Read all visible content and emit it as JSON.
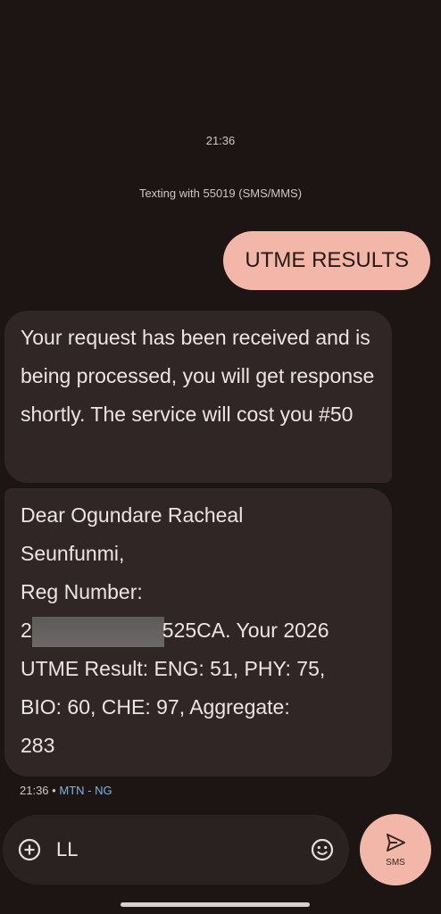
{
  "thread": {
    "time_header": "21:36",
    "info": "Texting with 55019 (SMS/MMS)"
  },
  "messages": {
    "outgoing_1": "UTME RESULTS",
    "incoming_1": "Your request has been received and is being processed, you will get response shortly. The service will cost you #50",
    "incoming_2": {
      "line1": "Dear Ogundare Racheal",
      "line2": "Seunfunmi,",
      "line3": "Reg Number:",
      "reg_prefix": "2",
      "reg_suffix": "525CA. Your 2026",
      "line5": "UTME Result: ENG: 51, PHY: 75,",
      "line6": "BIO: 60, CHE: 97, Aggregate:",
      "line7": "283"
    },
    "meta": {
      "time": "21:36",
      "separator": "•",
      "carrier": "MTN - NG"
    }
  },
  "compose": {
    "value": "LL",
    "add_icon": "add-circle-icon",
    "emoji_icon": "emoji-icon"
  },
  "send": {
    "label": "SMS",
    "icon": "send-icon"
  },
  "colors": {
    "background": "#1d1514",
    "outgoing_bubble": "#f3b7aa",
    "incoming_bubble": "#2f2625",
    "carrier_text": "#7fb6d9"
  }
}
